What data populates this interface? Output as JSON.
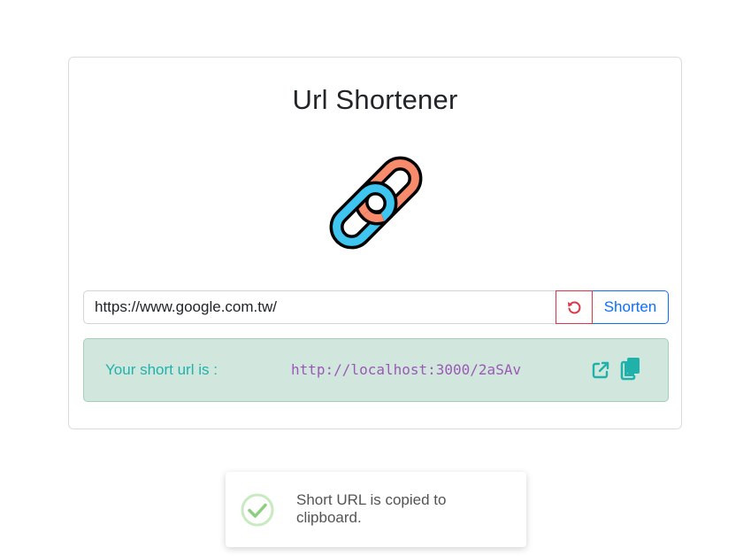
{
  "app": {
    "title": "Url Shortener",
    "logo_icon": "link-chain-icon"
  },
  "form": {
    "url_value": "https://www.google.com.tw/",
    "reset_icon": "undo-icon",
    "shorten_label": "Shorten"
  },
  "result": {
    "label": "Your short url is :",
    "short_url": "http://localhost:3000/2aSAv",
    "open_icon": "external-link-icon",
    "copy_icon": "copy-icon"
  },
  "toast": {
    "message": "Short URL is copied to clipboard.",
    "icon": "check-circle-icon"
  },
  "colors": {
    "success_bg": "#d1e7dd",
    "accent_teal": "#20b2aa",
    "primary": "#0d6efd",
    "danger": "#dc3545",
    "chain_orange": "#f78b6b",
    "chain_blue": "#3ec6f0"
  }
}
